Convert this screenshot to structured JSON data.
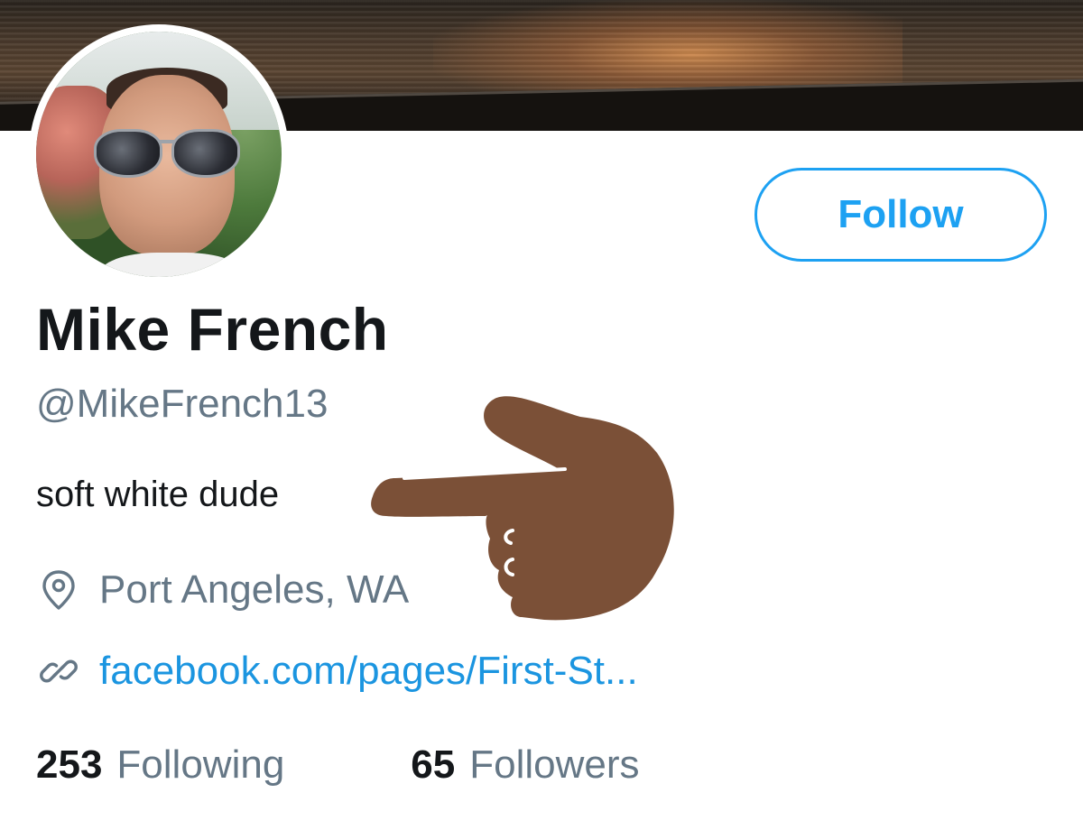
{
  "profile": {
    "name": "Mike French",
    "handle": "@MikeFrench13",
    "bio": "soft white dude",
    "location": "Port Angeles, WA",
    "website": "facebook.com/pages/First-St...",
    "follow_label": "Follow"
  },
  "stats": {
    "following_count": "253",
    "following_label": "Following",
    "followers_count": "65",
    "followers_label": "Followers"
  },
  "icons": {
    "location": "location-pin-icon",
    "website": "link-icon",
    "overlay": "pointing-hand-emoji"
  },
  "colors": {
    "accent": "#1da1f2",
    "link": "#1b95e0",
    "secondary_text": "#657786",
    "primary_text": "#14171a",
    "hand": "#7b5037"
  }
}
